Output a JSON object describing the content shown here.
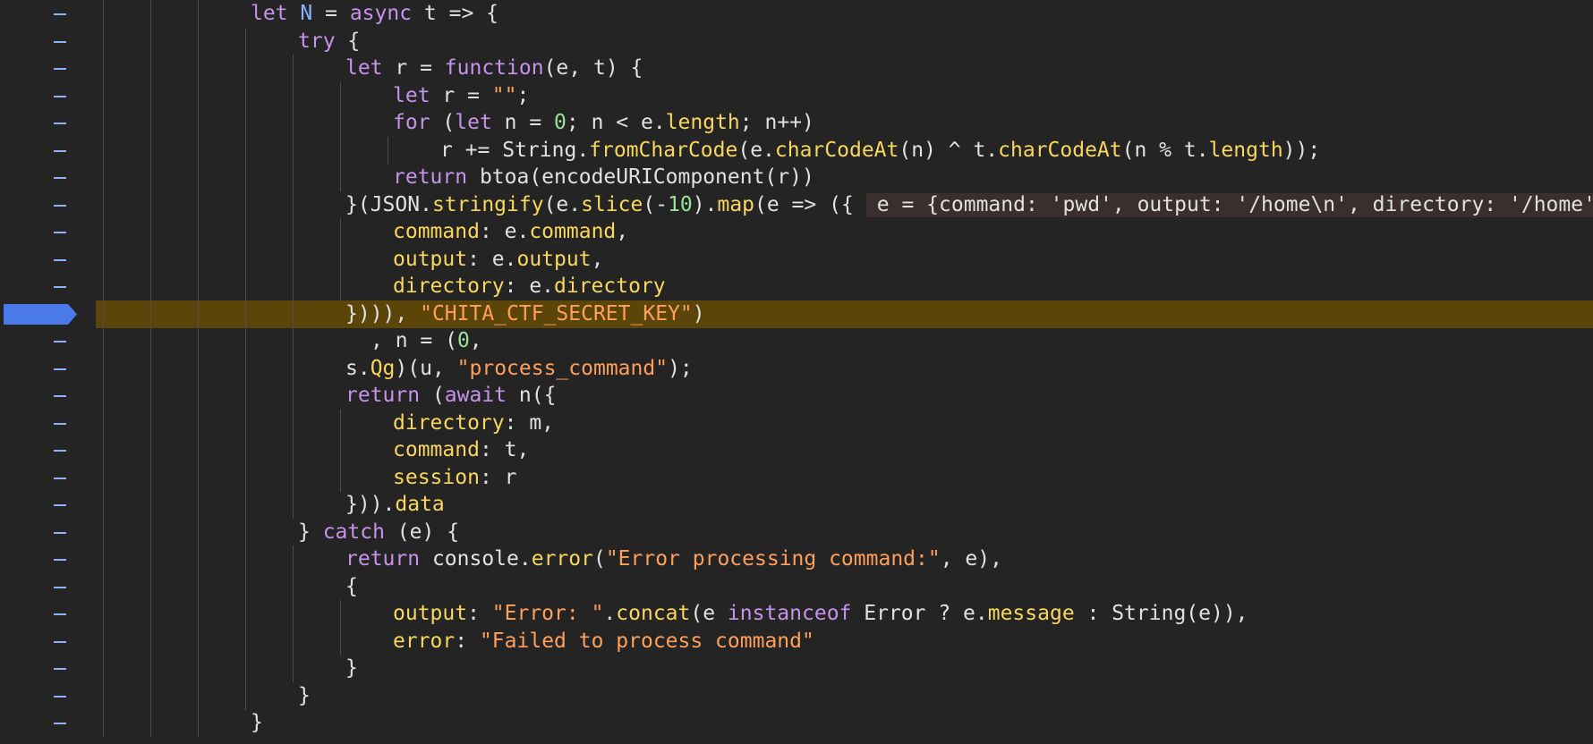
{
  "editor": {
    "hint_text": "e = {command: 'pwd', output: '/home\\n', directory: '/home'}",
    "active_line_index": 11,
    "breakpoint_line_index": 11,
    "accent_color": "#5b4508",
    "breakpoint_color": "#4a7ae8"
  },
  "lines": [
    "let N = async t => {",
    "try {",
    "let r = function(e, t) {",
    "let r = \"\";",
    "for (let n = 0; n < e.length; n++)",
    "r += String.fromCharCode(e.charCodeAt(n) ^ t.charCodeAt(n % t.length));",
    "return btoa(encodeURIComponent(r))",
    "}(JSON.stringify(e.slice(-10).map(e => ({",
    "command: e.command,",
    "output: e.output,",
    "directory: e.directory",
    "}))), \"CHITA_CTF_SECRET_KEY\")",
    ", n = (0,",
    "s.Qg)(u, \"process_command\");",
    "return (await n({",
    "directory: m,",
    "command: t,",
    "session: r",
    "})).data",
    "} catch (e) {",
    "return console.error(\"Error processing command:\", e),",
    "{",
    "output: \"Error: \".concat(e instanceof Error ? e.message : String(e)),",
    "error: \"Failed to process command\"",
    "}",
    "}",
    "}"
  ]
}
